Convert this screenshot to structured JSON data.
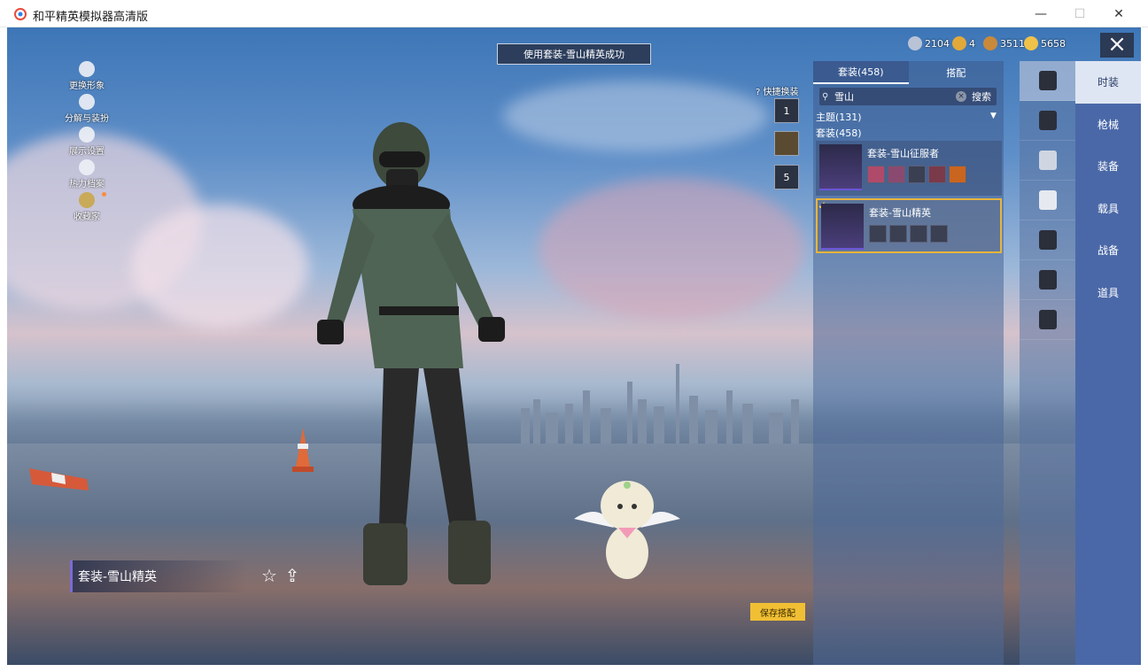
{
  "window": {
    "title": "和平精英模拟器高清版",
    "minimize": "—",
    "maximize": "☐",
    "close": "✕"
  },
  "toast": "使用套装-雪山精英成功",
  "currencies": [
    {
      "icon": "silver-coin-icon",
      "value": "2104",
      "color": "#b9c3d6"
    },
    {
      "icon": "medal-icon",
      "value": "4",
      "color": "#e1a93a"
    },
    {
      "icon": "bronze-coin-icon",
      "value": "3511",
      "color": "#c9893a"
    },
    {
      "icon": "gold-coin-icon",
      "value": "5658",
      "color": "#f0c24a"
    }
  ],
  "left_menu": [
    {
      "label": "更换形象",
      "icon": "person-icon"
    },
    {
      "label": "分解与装扮",
      "icon": "gear-icon"
    },
    {
      "label": "展示设置",
      "icon": "eye-icon"
    },
    {
      "label": "热力档案",
      "icon": "flame-icon"
    },
    {
      "label": "收藏家",
      "icon": "collector-badge-icon"
    }
  ],
  "outfit_name": "套装-雪山精英",
  "quick_change": {
    "label": "快捷换装",
    "slots": [
      "1",
      "",
      "5"
    ]
  },
  "panel": {
    "tabs": [
      "套装(458)",
      "搭配"
    ],
    "search_value": "雪山",
    "search_button": "搜索",
    "theme_row": "主题(131)",
    "suit_row": "套装(458)",
    "cards": [
      {
        "name": "套装-雪山征服者",
        "parts": 5,
        "selected": false
      },
      {
        "name": "套装-雪山精英",
        "parts": 4,
        "selected": true
      }
    ]
  },
  "categories": [
    {
      "label": "时装",
      "active": true
    },
    {
      "label": "枪械",
      "active": false
    },
    {
      "label": "装备",
      "active": false
    },
    {
      "label": "载具",
      "active": false
    },
    {
      "label": "战备",
      "active": false
    },
    {
      "label": "道具",
      "active": false
    }
  ],
  "save_button": "保存搭配"
}
